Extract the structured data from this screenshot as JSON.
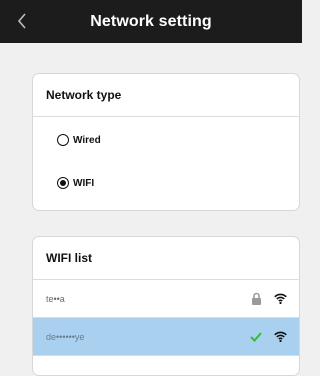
{
  "header": {
    "title": "Network setting"
  },
  "network_type": {
    "title": "Network type",
    "options": [
      {
        "label": "Wired",
        "selected": false
      },
      {
        "label": "WIFI",
        "selected": true
      }
    ]
  },
  "wifi_list": {
    "title": "WIFI list",
    "networks": [
      {
        "name": "te••a",
        "locked": true,
        "connected": false,
        "selected": false
      },
      {
        "name": "de••••••ye",
        "locked": false,
        "connected": true,
        "selected": true
      }
    ]
  },
  "colors": {
    "header_bg": "#1c1c1c",
    "selected_row": "#a9d0ef",
    "check": "#2fbf2f"
  }
}
